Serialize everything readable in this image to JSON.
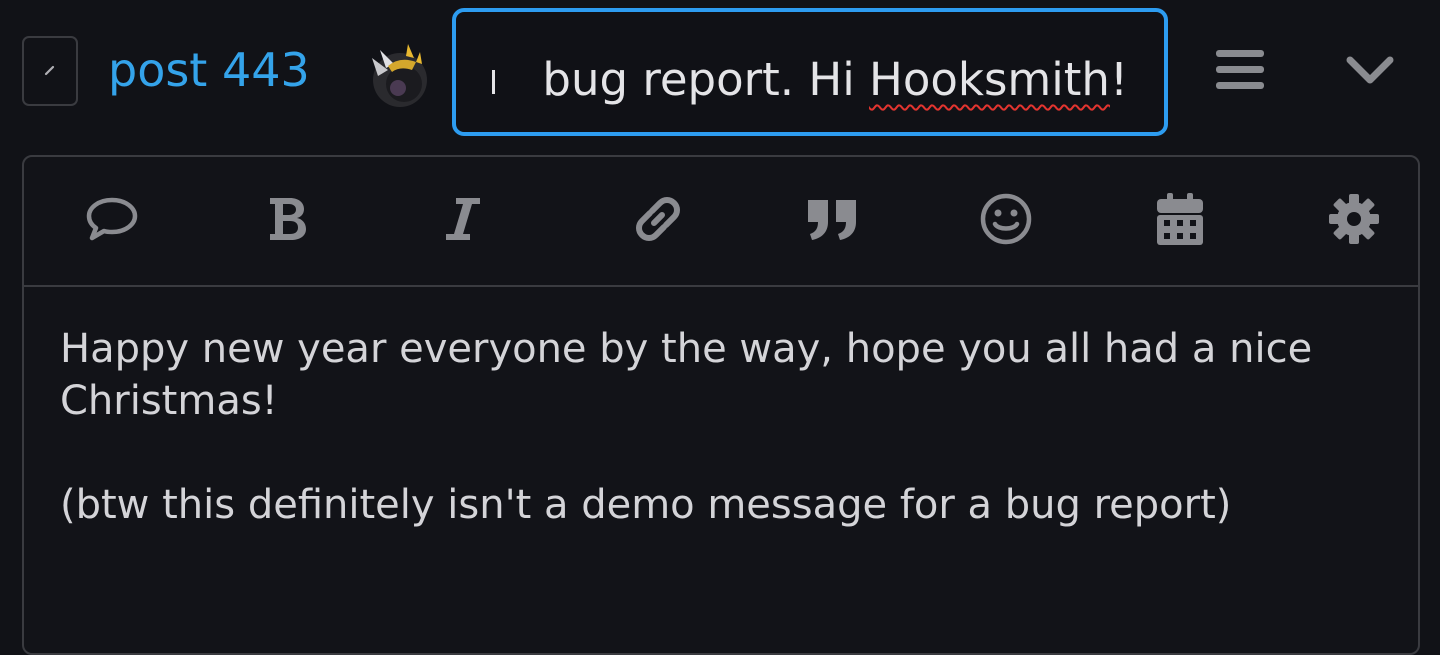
{
  "header": {
    "post_link": "post 443",
    "title_visible_text": " bug report. Hi ",
    "title_misspelled_word": "Hooksmith",
    "title_end": "!",
    "icons": [
      "pencil-icon",
      "menu-icon",
      "chevron-down-icon"
    ]
  },
  "toolbar": {
    "buttons": [
      "speech-bubble-icon",
      "bold-icon",
      "italic-icon",
      "link-icon",
      "quote-icon",
      "emoji-icon",
      "calendar-icon",
      "gear-icon"
    ]
  },
  "editor": {
    "line1": "Happy new year everyone by the way, hope you all had a nice Christmas!",
    "line2": "",
    "line3": "(btw this definitely isn't a demo message for a bug report)"
  },
  "colors": {
    "background": "#111217",
    "accent": "#34a3ea",
    "focus_border": "#2d9cf0",
    "border": "#3a3b40",
    "icon": "#8a8b90",
    "spell_error": "#e3342f"
  }
}
